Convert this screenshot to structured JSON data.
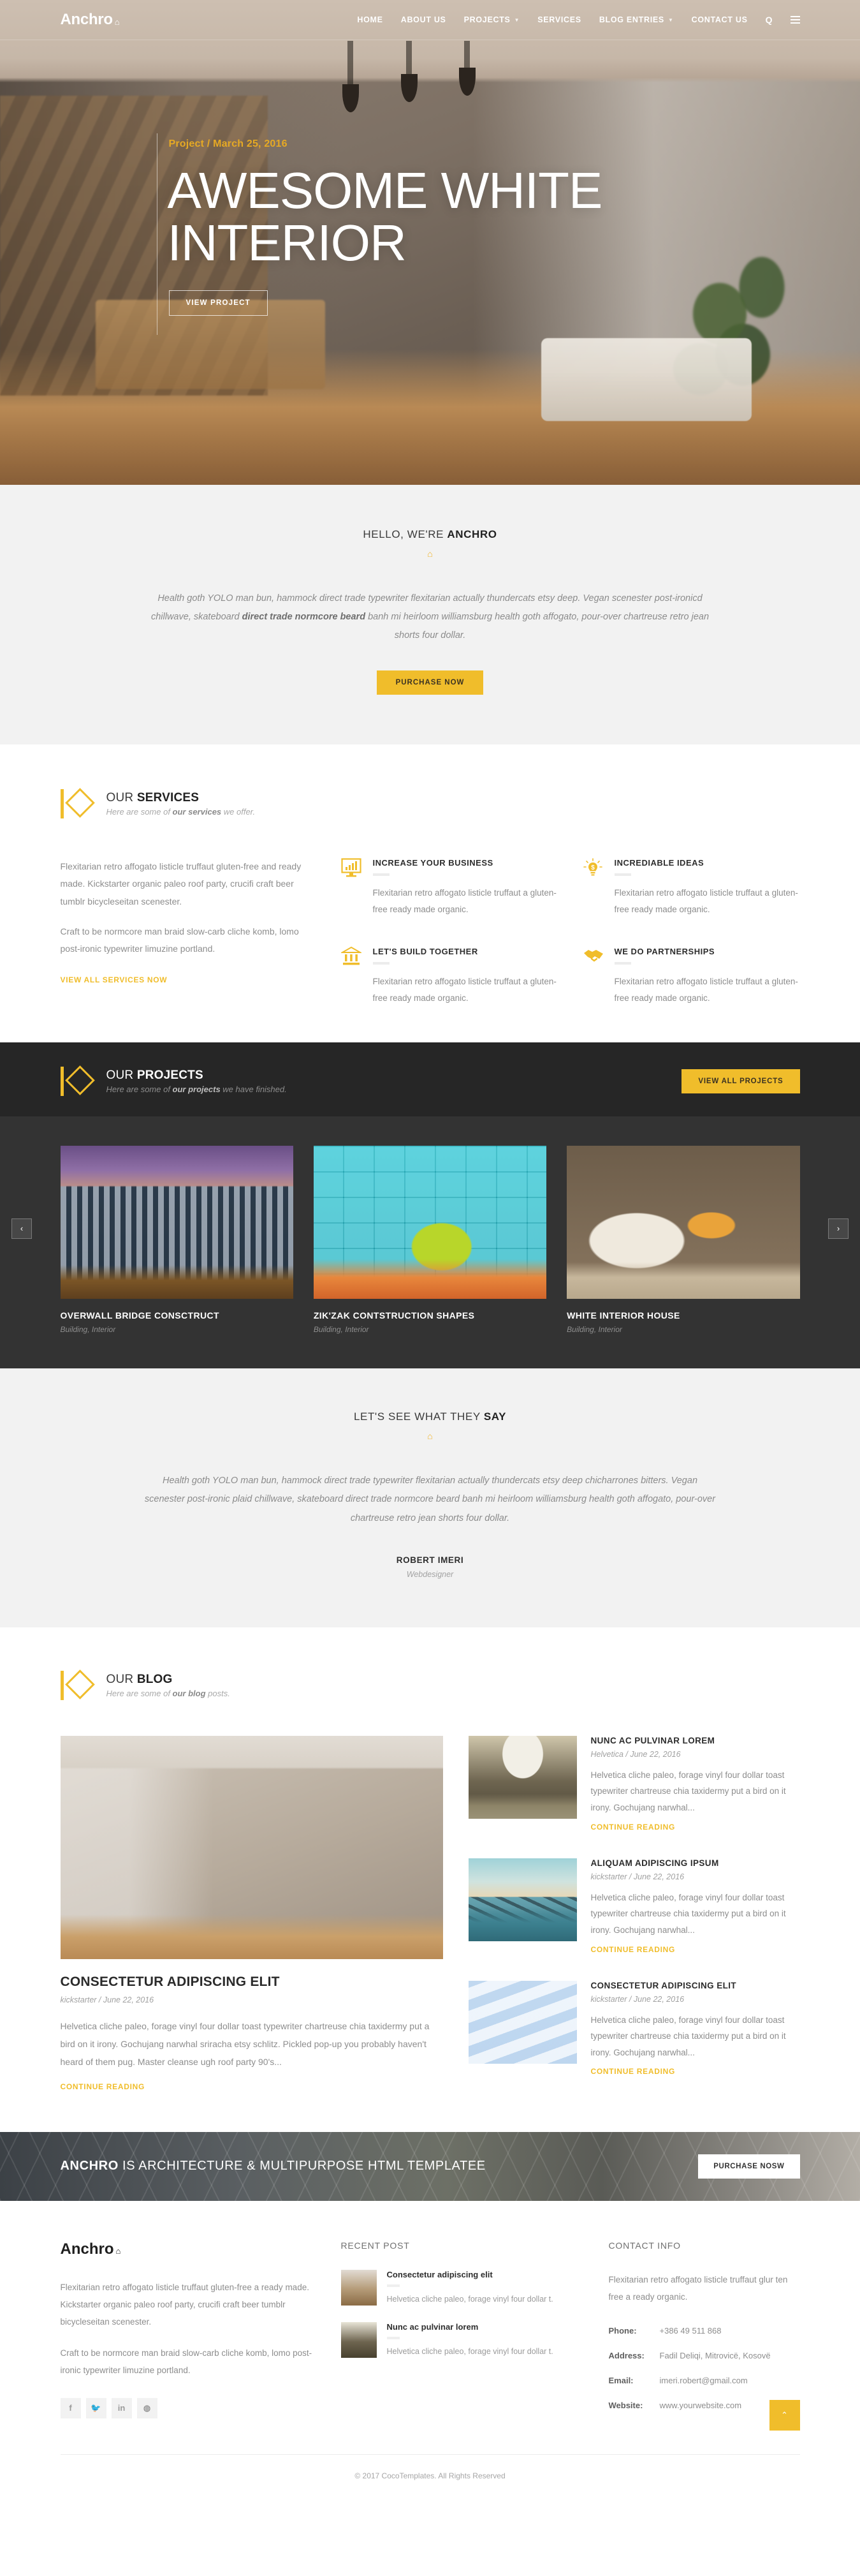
{
  "header": {
    "brand": "Anchro",
    "brand_diamond": "⌂",
    "nav": [
      {
        "label": "HOME",
        "caret": false
      },
      {
        "label": "ABOUT US",
        "caret": false
      },
      {
        "label": "PROJECTS",
        "caret": true
      },
      {
        "label": "SERVICES",
        "caret": false
      },
      {
        "label": "BLOG ENTRIES",
        "caret": true
      },
      {
        "label": "CONTACT US",
        "caret": false
      }
    ],
    "search_icon": "Q"
  },
  "hero": {
    "meta": "Project / March 25, 2016",
    "title_line1": "AWESOME WHITE",
    "title_line2": "INTERIOR",
    "button": "VIEW PROJECT"
  },
  "hello": {
    "title_normal": "HELLO, WE'RE ",
    "title_bold": "ANCHRO",
    "paragraph_1": "Health goth YOLO man bun, hammock direct trade typewriter flexitarian actually thundercats etsy deep. Vegan scenester post-ironicd chillwave, skateboard ",
    "paragraph_bold": "direct trade normcore beard",
    "paragraph_2": " banh mi heirloom williamsburg health goth affogato, pour-over chartreuse retro jean shorts four dollar.",
    "button": "PURCHASE NOW"
  },
  "services": {
    "head_normal": "OUR ",
    "head_bold": "SERVICES",
    "sub_pre": "Here are some of ",
    "sub_bold": "our services",
    "sub_post": " we offer.",
    "left_p1": "Flexitarian retro affogato listicle truffaut gluten-free and ready made. Kickstarter organic paleo roof party, crucifi craft beer tumblr bicycleseitan scenester.",
    "left_p2": "Craft to be normcore man braid slow-carb cliche komb, lomo post-ironic typewriter limuzine portland.",
    "link": "VIEW ALL SERVICES NOW",
    "items": [
      {
        "icon": "chart-monitor-icon",
        "title": "INCREASE YOUR BUSINESS",
        "text": "Flexitarian retro affogato listicle truffaut a gluten-free ready made organic."
      },
      {
        "icon": "lightbulb-icon",
        "title": "INCREDIABLE IDEAS",
        "text": "Flexitarian retro affogato listicle truffaut a gluten-free ready made organic."
      },
      {
        "icon": "bank-icon",
        "title": "LET'S BUILD TOGETHER",
        "text": "Flexitarian retro affogato listicle truffaut a gluten-free ready made organic."
      },
      {
        "icon": "handshake-icon",
        "title": "WE DO PARTNERSHIPS",
        "text": "Flexitarian retro affogato listicle truffaut a gluten-free ready made organic."
      }
    ]
  },
  "projects": {
    "head_normal": "OUR ",
    "head_bold": "PROJECTS",
    "sub_pre": "Here are some of ",
    "sub_bold": "our projects",
    "sub_post": " we have finished.",
    "button": "VIEW ALL PROJECTS",
    "prev": "‹",
    "next": "›",
    "items": [
      {
        "title": "OVERWALL BRIDGE CONSCTRUCT",
        "tag": "Building, Interior"
      },
      {
        "title": "ZIK'ZAK CONTSTRUCTION SHAPES",
        "tag": "Building, Interior"
      },
      {
        "title": "WHITE INTERIOR HOUSE",
        "tag": "Building, Interior"
      }
    ]
  },
  "testimonial": {
    "title_normal": "LET'S SEE WHAT THEY ",
    "title_bold": "SAY",
    "quote": "Health goth YOLO man bun, hammock direct trade typewriter flexitarian actually thundercats etsy deep chicharrones bitters. Vegan scenester post-ironic plaid chillwave, skateboard direct trade normcore beard banh mi heirloom williamsburg health goth affogato, pour-over chartreuse retro jean shorts four dollar.",
    "author": "ROBERT IMERI",
    "role": "Webdesigner"
  },
  "blog": {
    "head_normal": "OUR ",
    "head_bold": "BLOG",
    "sub_pre": "Here are some of ",
    "sub_bold": "our blog",
    "sub_post": " posts.",
    "main": {
      "title": "CONSECTETUR ADIPISCING ELIT",
      "meta": "kickstarter / June 22, 2016",
      "excerpt": "Helvetica cliche paleo, forage vinyl four dollar toast typewriter chartreuse chia taxidermy put a bird on it irony. Gochujang narwhal sriracha etsy schlitz. Pickled pop-up you probably haven't heard of them pug. Master cleanse ugh roof party 90's...",
      "read": "CONTINUE READING"
    },
    "side": [
      {
        "title": "NUNC AC PULVINAR LOREM",
        "meta": "Helvetica / June 22, 2016",
        "excerpt": "Helvetica cliche paleo, forage vinyl four dollar toast typewriter chartreuse chia taxidermy put a bird on it irony. Gochujang narwhal...",
        "read": "CONTINUE READING"
      },
      {
        "title": "ALIQUAM ADIPISCING IPSUM",
        "meta": "kickstarter / June 22, 2016",
        "excerpt": "Helvetica cliche paleo, forage vinyl four dollar toast typewriter chartreuse chia taxidermy put a bird on it irony. Gochujang narwhal...",
        "read": "CONTINUE READING"
      },
      {
        "title": "CONSECTETUR ADIPISCING ELIT",
        "meta": "kickstarter / June 22, 2016",
        "excerpt": "Helvetica cliche paleo, forage vinyl four dollar toast typewriter chartreuse chia taxidermy put a bird on it irony. Gochujang narwhal...",
        "read": "CONTINUE READING"
      }
    ]
  },
  "cta": {
    "bold": "ANCHRO",
    "rest": " IS ARCHITECTURE & MULTIPURPOSE HTML TEMPLATEE",
    "button": "PURCHASE NOSW"
  },
  "footer": {
    "brand": "Anchro",
    "brand_diamond": "⌂",
    "about_p1": "Flexitarian retro affogato listicle truffaut gluten-free a ready made. Kickstarter organic paleo roof party, crucifi craft beer tumblr bicycleseitan scenester.",
    "about_p2": "Craft to be normcore man braid slow-carb cliche komb, lomo post-ironic typewriter limuzine portland.",
    "socials": [
      {
        "name": "facebook-icon",
        "glyph": "f"
      },
      {
        "name": "twitter-icon",
        "glyph": "🐦"
      },
      {
        "name": "linkedin-icon",
        "glyph": "in"
      },
      {
        "name": "dribbble-icon",
        "glyph": "◍"
      }
    ],
    "recent_title": "RECENT POST",
    "recent": [
      {
        "title": "Consectetur adipiscing elit",
        "text": "Helvetica cliche paleo, forage vinyl four dollar t."
      },
      {
        "title": "Nunc ac pulvinar lorem",
        "text": "Helvetica cliche paleo, forage vinyl four dollar t."
      }
    ],
    "contact_title": "CONTACT INFO",
    "contact_intro": "Flexitarian retro affogato listicle truffaut glur ten free a ready organic.",
    "contact_rows": [
      {
        "key": "Phone:",
        "value": "+386 49 511 868"
      },
      {
        "key": "Address:",
        "value": "Fadil Deliqi, Mitrovicë, Kosovë"
      },
      {
        "key": "Email:",
        "value": "imeri.robert@gmail.com"
      },
      {
        "key": "Website:",
        "value": "www.yourwebsite.com"
      }
    ],
    "to_top": "⌃",
    "copyright": "© 2017 CocoTemplates. All Rights Reserved"
  },
  "colors": {
    "accent": "#f0bd2b",
    "dark": "#262626",
    "panel": "#333333",
    "grey_bg": "#f2f2f2"
  }
}
